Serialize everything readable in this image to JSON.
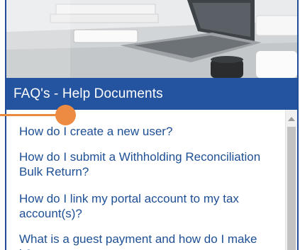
{
  "header": {
    "title": "FAQ's - Help Documents"
  },
  "faq": {
    "items": [
      {
        "label": "How do I create a new user?"
      },
      {
        "label": "How do I submit a Withholding Reconciliation Bulk Return?"
      },
      {
        "label": "How do I link my portal account to my tax account(s)?"
      },
      {
        "label": "What is a guest payment and how do I make it?"
      }
    ]
  },
  "colors": {
    "header_bg": "#2453a0",
    "link": "#1e4f95",
    "callout": "#ec8b41",
    "border": "#1f4e96"
  },
  "icons": {
    "scroll_up": "scroll-up-arrow-icon"
  }
}
